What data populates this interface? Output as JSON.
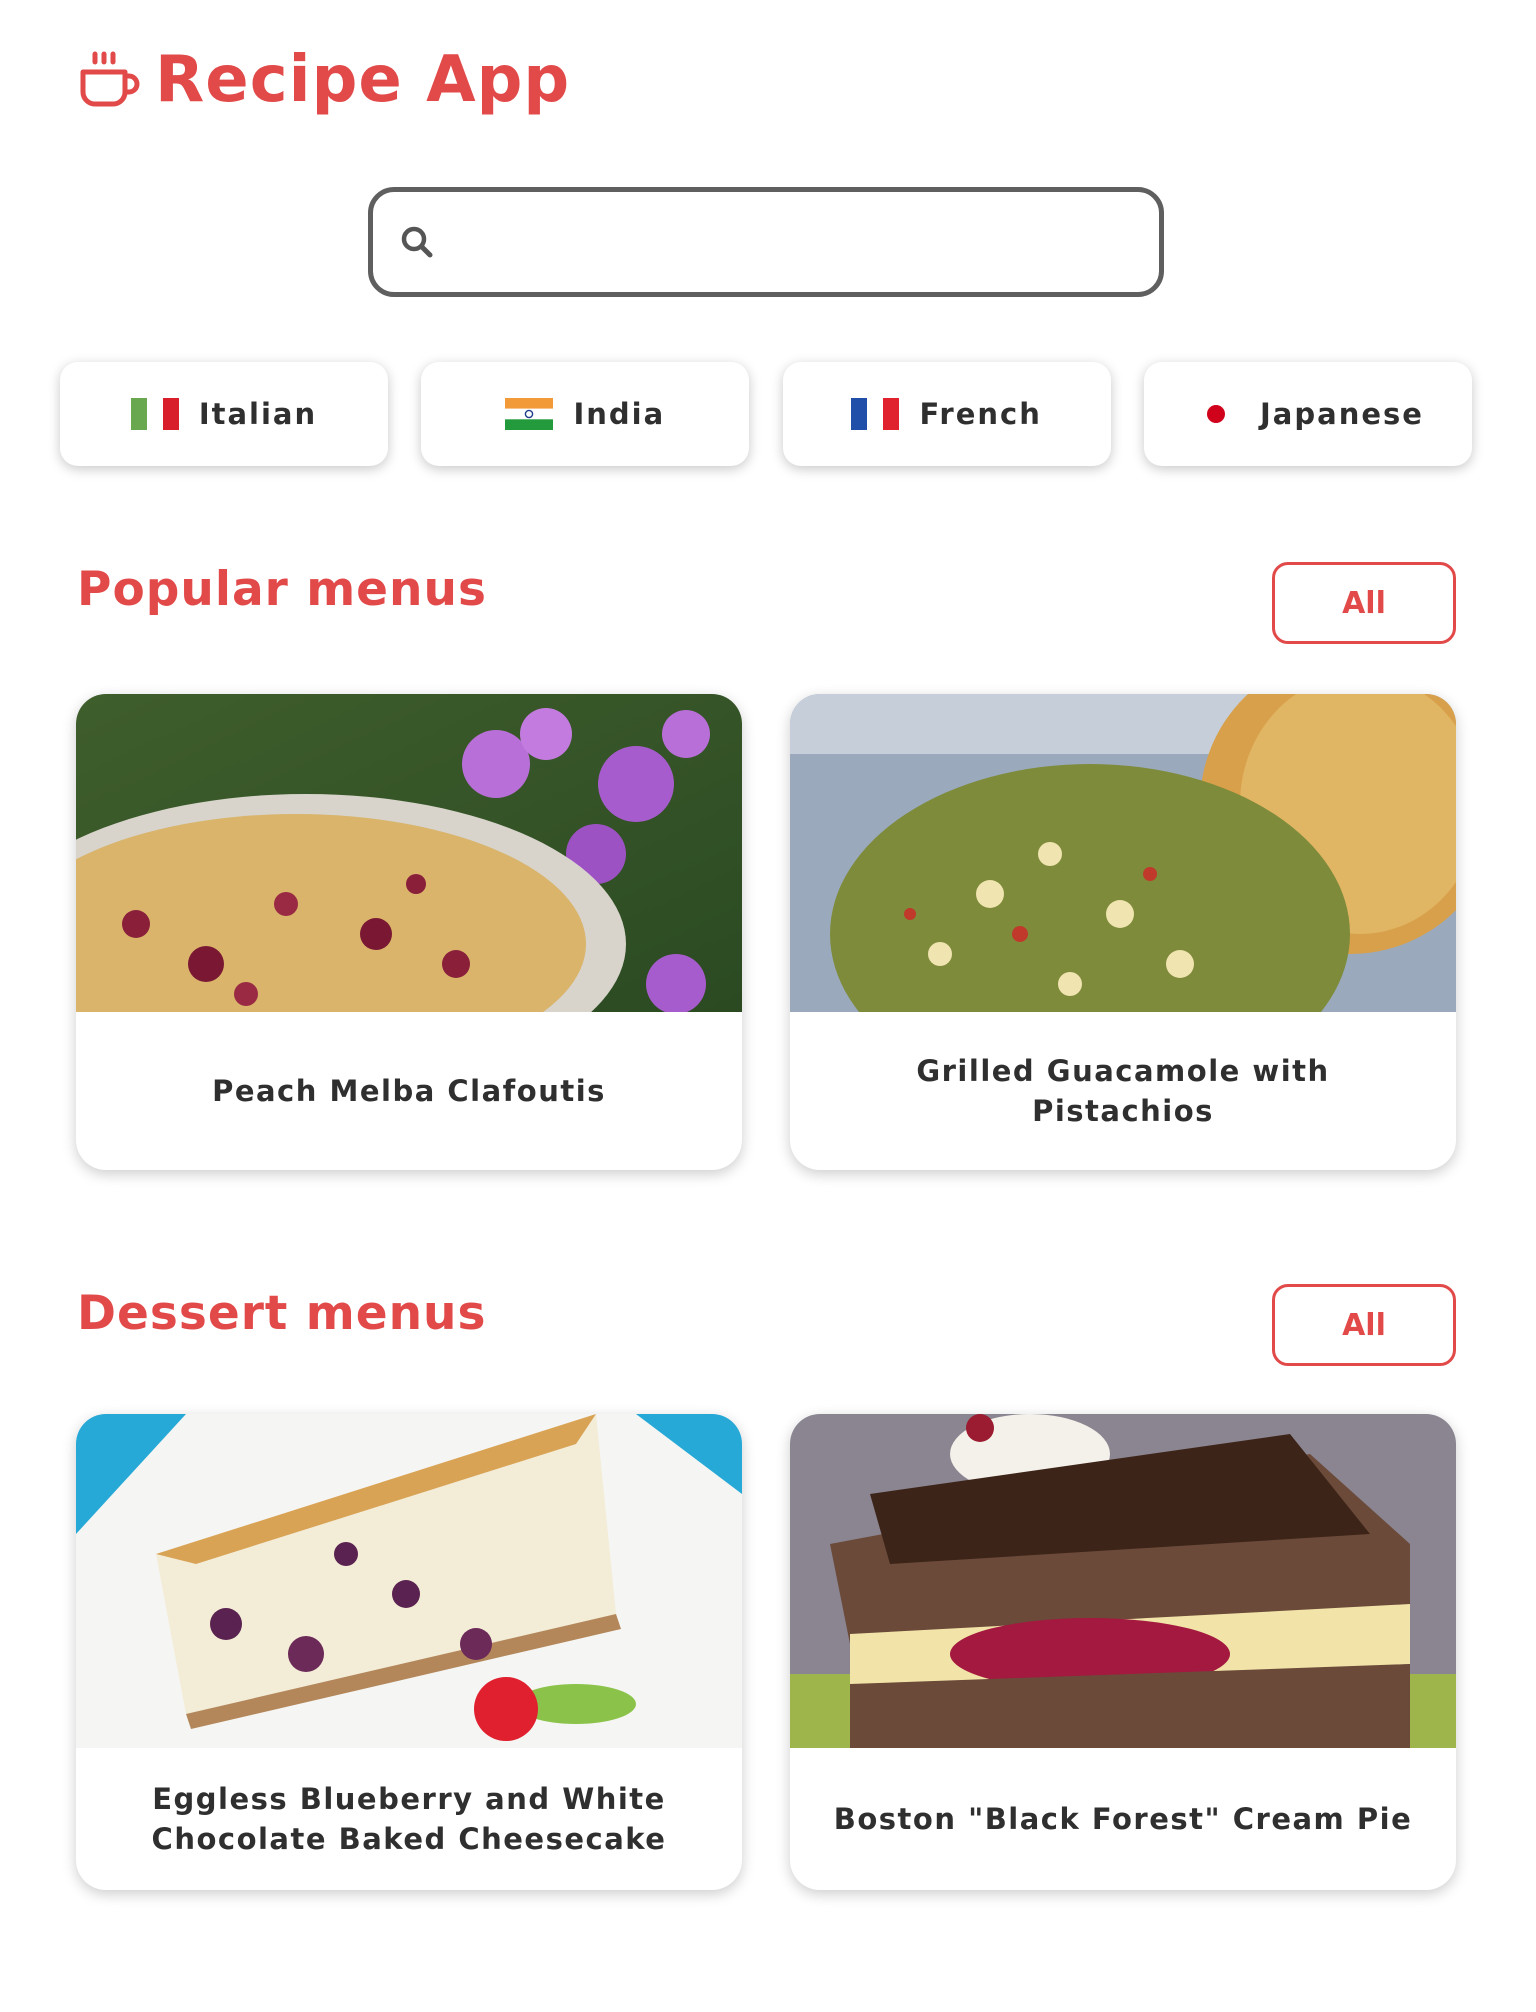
{
  "app": {
    "title": "Recipe App",
    "logo_icon": "coffee-cup-icon",
    "accent_color": "#e24a4a"
  },
  "search": {
    "placeholder": "",
    "value": "",
    "icon": "search-icon"
  },
  "cuisines": [
    {
      "label": "Italian",
      "flag": "italy-flag"
    },
    {
      "label": "India",
      "flag": "india-flag"
    },
    {
      "label": "French",
      "flag": "france-flag"
    },
    {
      "label": "Japanese",
      "flag": "japan-flag"
    }
  ],
  "sections": {
    "popular": {
      "title": "Popular menus",
      "all_label": "All",
      "cards": [
        {
          "title": "Peach Melba Clafoutis"
        },
        {
          "title": "Grilled Guacamole with Pistachios"
        }
      ]
    },
    "dessert": {
      "title": "Dessert menus",
      "all_label": "All",
      "cards": [
        {
          "title": "Eggless Blueberry and White Chocolate Baked Cheesecake"
        },
        {
          "title": "Boston \"Black Forest\" Cream Pie"
        }
      ]
    }
  }
}
